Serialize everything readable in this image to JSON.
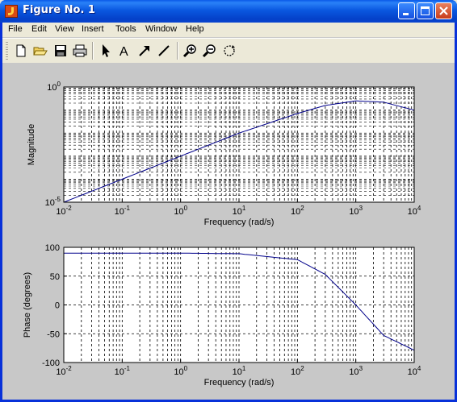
{
  "window": {
    "title": "Figure No. 1"
  },
  "menu": [
    "File",
    "Edit",
    "View",
    "Insert",
    "Tools",
    "Window",
    "Help"
  ],
  "toolbar": [
    "new-file-icon",
    "open-folder-icon",
    "save-icon",
    "print-icon",
    "select-arrow-icon",
    "insert-text-icon",
    "insert-arrow-icon",
    "insert-line-icon",
    "zoom-in-icon",
    "zoom-out-icon",
    "rotate-3d-icon"
  ],
  "colors": {
    "title_bar": "#0a58e0",
    "plot_bg": "#ffffff",
    "figure_bg": "#c8c8c8",
    "curve": "#00008b"
  },
  "chart_data": [
    {
      "type": "line",
      "xscale": "log",
      "yscale": "log",
      "xlim": [
        0.01,
        10000
      ],
      "ylim": [
        1e-05,
        1
      ],
      "xlabel": "Frequency (rad/s)",
      "ylabel": "Magnitude",
      "x_ticks": [
        "10^-2",
        "10^-1",
        "10^0",
        "10^1",
        "10^2",
        "10^3",
        "10^4"
      ],
      "y_ticks": [
        "10^-5",
        "10^0"
      ],
      "grid": true,
      "series": [
        {
          "x": [
            0.01,
            0.1,
            1,
            10,
            100,
            300,
            1000,
            3000,
            10000
          ],
          "y": [
            1e-05,
            0.0001,
            0.001,
            0.00995,
            0.0707,
            0.158,
            0.25,
            0.22,
            0.099
          ]
        }
      ]
    },
    {
      "type": "line",
      "xscale": "log",
      "xlim": [
        0.01,
        10000
      ],
      "ylim": [
        -100,
        100
      ],
      "xlabel": "Frequency (rad/s)",
      "ylabel": "Phase (degrees)",
      "x_ticks": [
        "10^-2",
        "10^-1",
        "10^0",
        "10^1",
        "10^2",
        "10^3",
        "10^4"
      ],
      "y_ticks": [
        "100",
        "50",
        "0",
        "-50",
        "-100"
      ],
      "grid": true,
      "series": [
        {
          "x": [
            0.01,
            1,
            10,
            100,
            300,
            1000,
            3000,
            10000
          ],
          "y": [
            90,
            89.9,
            88.9,
            78.6,
            53,
            0,
            -53,
            -78.6
          ]
        }
      ]
    }
  ]
}
